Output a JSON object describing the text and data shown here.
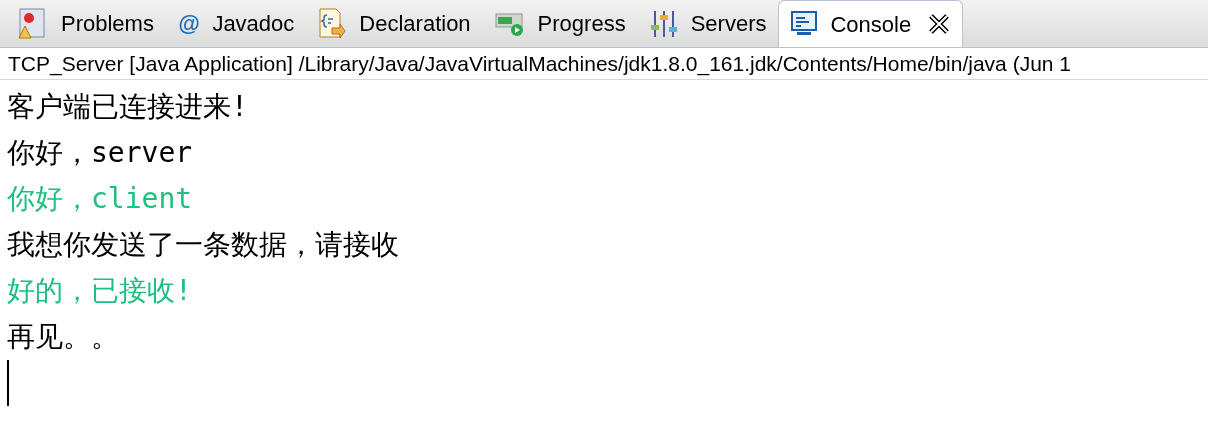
{
  "tabs": [
    {
      "label": "Problems",
      "selected": false
    },
    {
      "label": "Javadoc",
      "glyph": "@",
      "selected": false
    },
    {
      "label": "Declaration",
      "selected": false
    },
    {
      "label": "Progress",
      "selected": false
    },
    {
      "label": "Servers",
      "selected": false
    },
    {
      "label": "Console",
      "selected": true
    }
  ],
  "console": {
    "header": "TCP_Server [Java Application] /Library/Java/JavaVirtualMachines/jdk1.8.0_161.jdk/Contents/Home/bin/java (Jun 1",
    "lines": [
      {
        "text": "客户端已连接进来!",
        "kind": "output"
      },
      {
        "text": "你好，server",
        "kind": "output"
      },
      {
        "text": "你好，client",
        "kind": "input"
      },
      {
        "text": "我想你发送了一条数据，请接收",
        "kind": "output"
      },
      {
        "text": "好的，已接收!",
        "kind": "input"
      },
      {
        "text": "再见。。",
        "kind": "output"
      }
    ],
    "cursor": true
  }
}
